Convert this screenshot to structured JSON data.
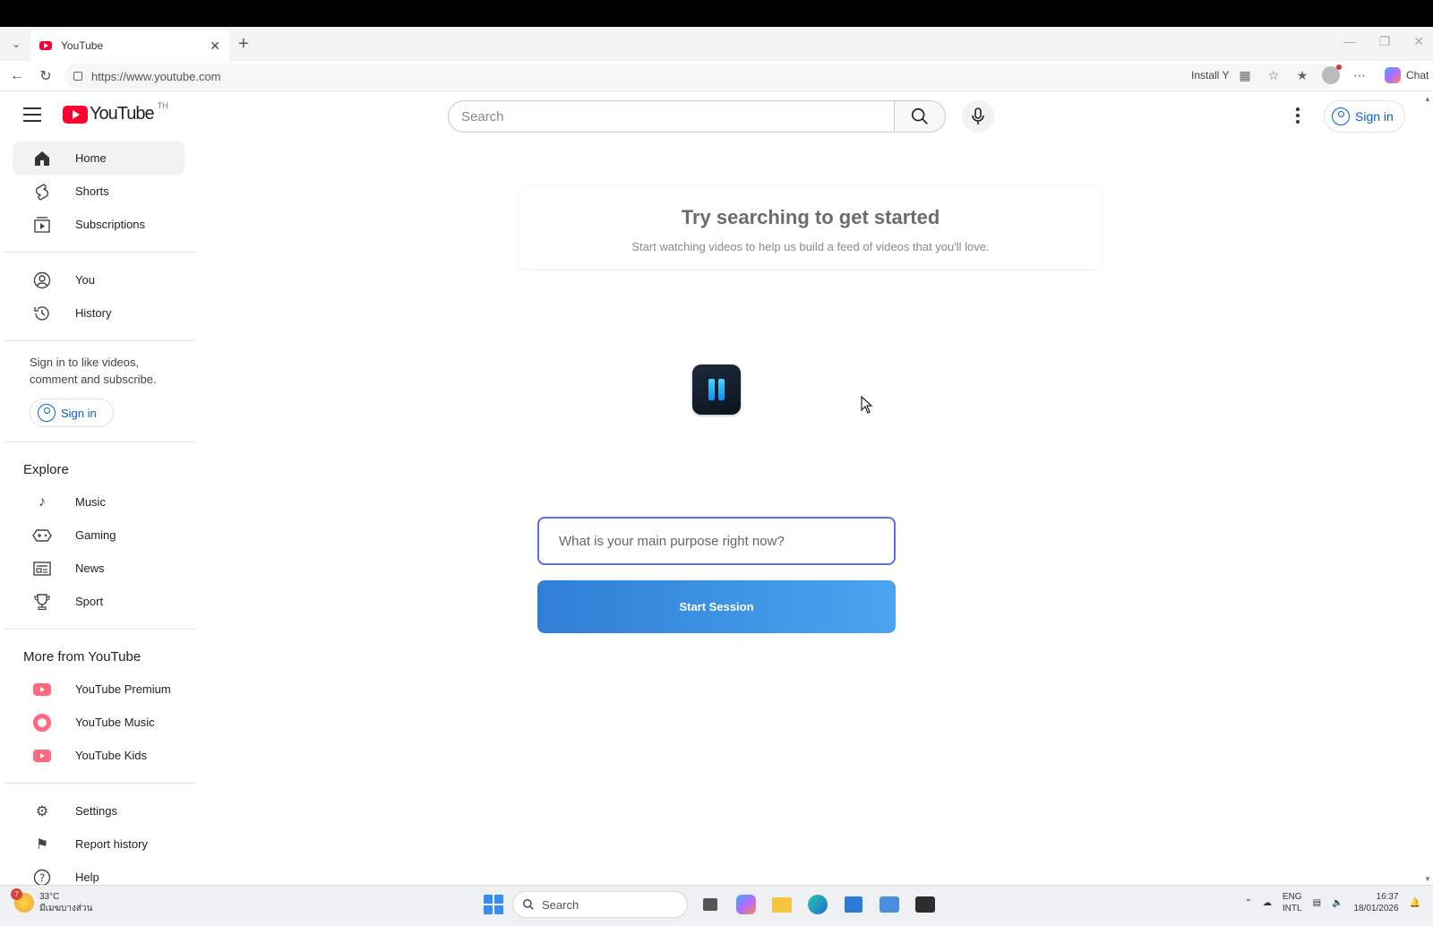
{
  "browser": {
    "tab_title": "YouTube",
    "url": "https://www.youtube.com",
    "install_text": "Install Y",
    "chat_label": "Chat"
  },
  "header": {
    "logo_word": "YouTube",
    "country_code": "TH",
    "search_placeholder": "Search",
    "signin_label": "Sign in"
  },
  "sidebar": {
    "main_items": [
      {
        "label": "Home",
        "icon": "home-icon"
      },
      {
        "label": "Shorts",
        "icon": "shorts-icon"
      },
      {
        "label": "Subscriptions",
        "icon": "subscriptions-icon"
      }
    ],
    "you_items": [
      {
        "label": "You",
        "icon": "you-icon"
      },
      {
        "label": "History",
        "icon": "history-icon"
      }
    ],
    "signin_blurb": "Sign in to like videos, comment and subscribe.",
    "signin_label": "Sign in",
    "explore_heading": "Explore",
    "explore_items": [
      {
        "label": "Music",
        "icon": "music-icon"
      },
      {
        "label": "Gaming",
        "icon": "gaming-icon"
      },
      {
        "label": "News",
        "icon": "news-icon"
      },
      {
        "label": "Sport",
        "icon": "trophy-icon"
      }
    ],
    "more_heading": "More from YouTube",
    "more_items": [
      {
        "label": "YouTube Premium",
        "icon": "youtube-premium-icon"
      },
      {
        "label": "YouTube Music",
        "icon": "youtube-music-icon"
      },
      {
        "label": "YouTube Kids",
        "icon": "youtube-kids-icon"
      }
    ],
    "footer_items": [
      {
        "label": "Settings",
        "icon": "gear-icon"
      },
      {
        "label": "Report history",
        "icon": "flag-icon"
      },
      {
        "label": "Help",
        "icon": "help-icon"
      }
    ]
  },
  "main": {
    "try_title": "Try searching to get started",
    "try_subtitle": "Start watching videos to help us build a feed of videos that you'll love.",
    "purpose_placeholder": "What is your main purpose right now?",
    "start_button": "Start Session"
  },
  "taskbar": {
    "weather_temp": "33°C",
    "weather_desc": "มีเมฆบางส่วน",
    "weather_badge": "7",
    "search_placeholder": "Search",
    "lang_top": "ENG",
    "lang_bottom": "INTL",
    "time": "16:37",
    "date": "18/01/2026"
  },
  "colors": {
    "youtube_red": "#ff0033",
    "link_blue": "#065fd4",
    "start_button": "#3b8fe2",
    "input_border": "#5a6ee6"
  }
}
